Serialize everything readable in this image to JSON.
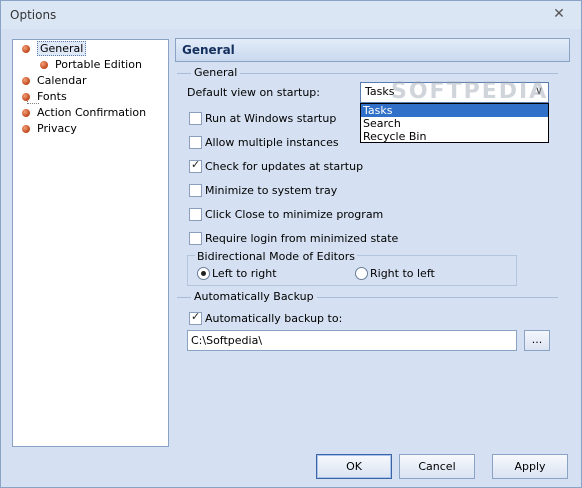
{
  "window": {
    "title": "Options",
    "close_glyph": "✕",
    "close_icon": "close-icon"
  },
  "sidebar": {
    "items": [
      {
        "label": "General",
        "selected": true,
        "icon": "orange-bullet-icon"
      },
      {
        "label": "Portable Edition",
        "icon": "orange-bullet-icon"
      },
      {
        "label": "Calendar",
        "icon": "orange-bullet-icon"
      },
      {
        "label": "Fonts",
        "icon": "orange-bullet-icon"
      },
      {
        "label": "Action Confirmation",
        "icon": "orange-bullet-icon"
      },
      {
        "label": "Privacy",
        "icon": "orange-bullet-icon"
      }
    ]
  },
  "panel": {
    "header": "General",
    "general_group": "General",
    "default_view_label": "Default view on startup:",
    "default_view_value": "Tasks",
    "default_view_chevron": "∨",
    "default_view_options": [
      "Tasks",
      "Search",
      "Recycle Bin"
    ],
    "checkboxes": [
      {
        "label": "Run at Windows startup",
        "checked": false
      },
      {
        "label": "Allow multiple instances",
        "checked": false
      },
      {
        "label": "Check for updates at startup",
        "checked": true
      },
      {
        "label": "Minimize to system tray",
        "checked": false
      },
      {
        "label": "Click Close to minimize program",
        "checked": false
      },
      {
        "label": "Require login from minimized state",
        "checked": false
      }
    ],
    "bidi": {
      "title": "Bidirectional Mode of Editors",
      "left_to_right": "Left to right",
      "right_to_left": "Right to left",
      "selected": "Left to right"
    },
    "backup_group": "Automatically Backup",
    "auto_backup_label": "Automatically backup to:",
    "auto_backup_checked": true,
    "backup_path": "C:\\Softpedia\\",
    "browse_label": "..."
  },
  "watermark": "SOFTPEDIA",
  "buttons": {
    "ok": "OK",
    "cancel": "Cancel",
    "apply": "Apply"
  },
  "colors": {
    "accent": "#3070c8",
    "header_text": "#15305e",
    "window_bg": "#d5e1f2"
  }
}
